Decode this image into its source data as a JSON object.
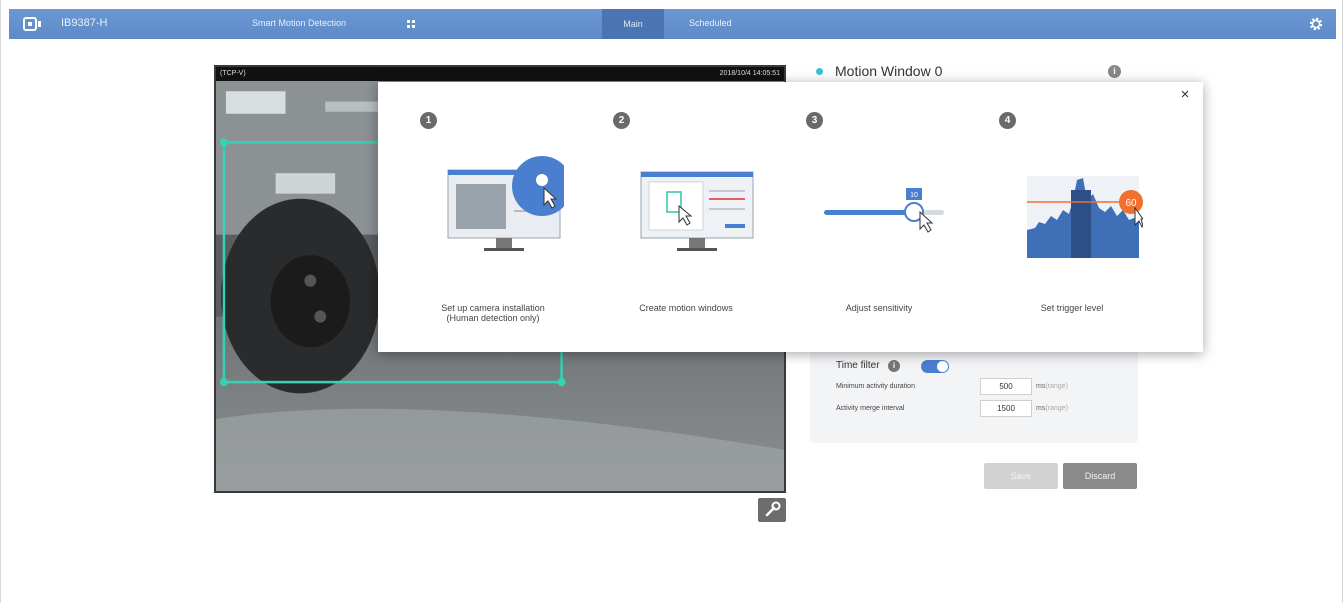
{
  "topbar": {
    "model": "IB9387-H",
    "app_title": "Smart Motion Detection",
    "tab_main": "Main",
    "tab_scheduled": "Scheduled"
  },
  "video": {
    "stream_label": "(TCP-V)",
    "timestamp": "2018/10/4 14:05:51"
  },
  "motion_window": {
    "title": "Motion Window 0",
    "accent_color": "#35c3d3"
  },
  "filters": {
    "time_filter_label": "Time filter",
    "time_filter_on": true,
    "min_activity_label": "Minimum activity duration",
    "min_activity_value": "500",
    "merge_interval_label": "Activity merge interval",
    "merge_interval_value": "1500",
    "unit": "ms",
    "range_hint": "(range)"
  },
  "actions": {
    "save_label": "Save",
    "discard_label": "Discard"
  },
  "tutorial": {
    "close_label": "×",
    "steps": [
      {
        "num": "1",
        "caption_line1": "Set up camera installation",
        "caption_line2": "(Human detection only)",
        "icon": "monitor-settings-icon"
      },
      {
        "num": "2",
        "caption_line1": "Create motion windows",
        "caption_line2": "",
        "icon": "monitor-windows-icon"
      },
      {
        "num": "3",
        "caption_line1": "Adjust sensitivity",
        "caption_line2": "",
        "icon": "sensitivity-slider-icon",
        "badge": "10"
      },
      {
        "num": "4",
        "caption_line1": "Set trigger level",
        "caption_line2": "",
        "icon": "trigger-level-icon",
        "badge": "60"
      }
    ]
  },
  "colors": {
    "topbar": "#5d8bc9",
    "accent_blue": "#4a7fd0",
    "window_outline": "#35d3b3",
    "trigger_orange": "#f07030"
  }
}
